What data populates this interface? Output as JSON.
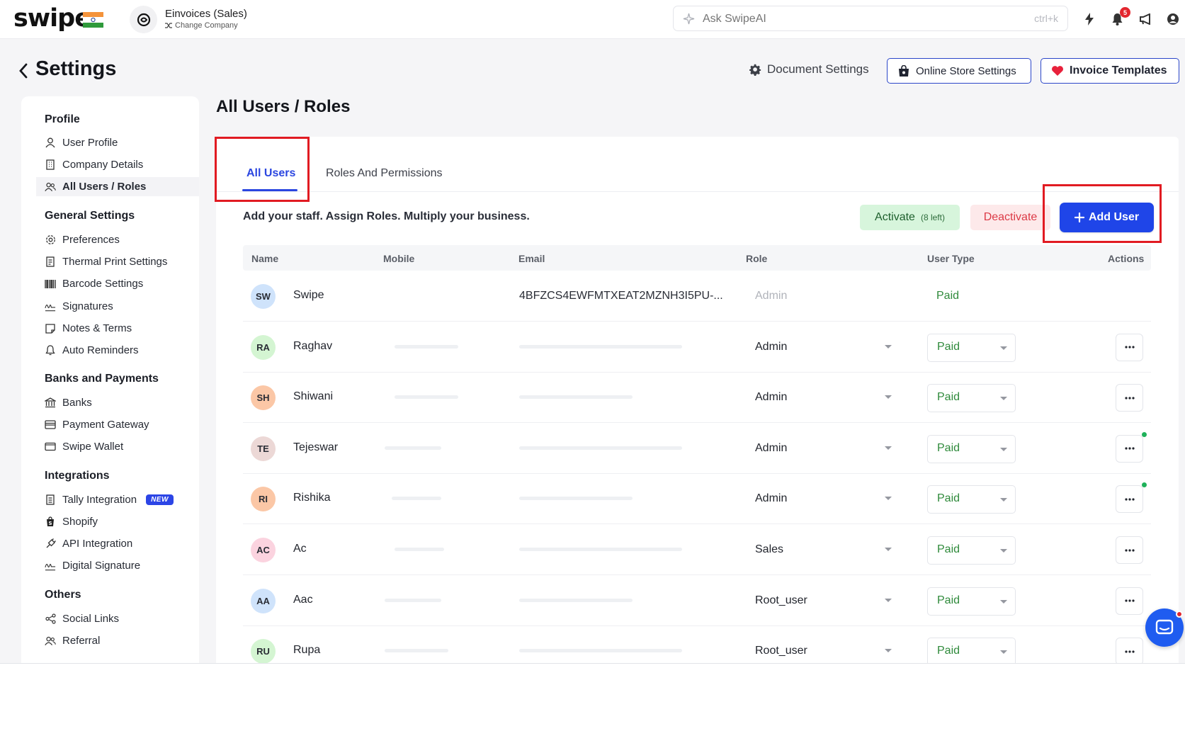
{
  "app": {
    "logo": "swipe",
    "company_name": "Einvoices (Sales)",
    "change_company": "Change Company",
    "ai_placeholder": "Ask SwipeAI",
    "ai_shortcut": "ctrl+k",
    "notification_count": "5"
  },
  "header": {
    "title": "Settings",
    "document_settings": "Document Settings",
    "online_store_settings": "Online Store Settings",
    "invoice_templates": "Invoice Templates"
  },
  "sidebar": {
    "sections": [
      {
        "title": "Profile",
        "items": [
          {
            "label": "User Profile",
            "icon": "user-icon"
          },
          {
            "label": "Company Details",
            "icon": "building-icon"
          },
          {
            "label": "All Users / Roles",
            "icon": "users-icon",
            "active": true
          }
        ]
      },
      {
        "title": "General Settings",
        "items": [
          {
            "label": "Preferences",
            "icon": "gear-icon"
          },
          {
            "label": "Thermal Print Settings",
            "icon": "receipt-icon"
          },
          {
            "label": "Barcode Settings",
            "icon": "barcode-icon"
          },
          {
            "label": "Signatures",
            "icon": "signature-icon"
          },
          {
            "label": "Notes & Terms",
            "icon": "note-icon"
          },
          {
            "label": "Auto Reminders",
            "icon": "bell-icon"
          }
        ]
      },
      {
        "title": "Banks and Payments",
        "items": [
          {
            "label": "Banks",
            "icon": "bank-icon"
          },
          {
            "label": "Payment Gateway",
            "icon": "card-icon"
          },
          {
            "label": "Swipe Wallet",
            "icon": "wallet-icon"
          }
        ]
      },
      {
        "title": "Integrations",
        "items": [
          {
            "label": "Tally Integration",
            "icon": "tally-icon",
            "badge": "NEW"
          },
          {
            "label": "Shopify",
            "icon": "shopify-icon"
          },
          {
            "label": "API Integration",
            "icon": "plug-icon"
          },
          {
            "label": "Digital Signature",
            "icon": "signature-icon"
          }
        ]
      },
      {
        "title": "Others",
        "items": [
          {
            "label": "Social Links",
            "icon": "share-icon"
          },
          {
            "label": "Referral",
            "icon": "users-icon"
          }
        ]
      }
    ]
  },
  "main": {
    "heading": "All Users / Roles",
    "tabs": [
      {
        "label": "All Users",
        "active": true
      },
      {
        "label": "Roles And Permissions",
        "active": false
      }
    ],
    "tagline": "Add your staff. Assign Roles. Multiply your business.",
    "activate_label": "Activate",
    "activate_count": "(8 left)",
    "deactivate_label": "Deactivate",
    "add_user_label": "Add User"
  },
  "table": {
    "columns": [
      "Name",
      "Mobile",
      "Email",
      "Role",
      "User Type",
      "Actions"
    ],
    "rows": [
      {
        "initials": "SW",
        "name": "Swipe",
        "email": "4BFZCS4EWFMTXEAT2MZNH3I5PU-...",
        "role": "Admin",
        "user_type": "Paid",
        "owner": true,
        "avatar_color": "#cfe3fb",
        "online": false
      },
      {
        "initials": "RA",
        "name": "Raghav",
        "email": "",
        "role": "Admin",
        "user_type": "Paid",
        "owner": false,
        "avatar_color": "#d4f5d2",
        "online": false
      },
      {
        "initials": "SH",
        "name": "Shiwani",
        "email": "",
        "role": "Admin",
        "user_type": "Paid",
        "owner": false,
        "avatar_color": "#fbc7a6",
        "online": false
      },
      {
        "initials": "TE",
        "name": "Tejeswar",
        "email": "",
        "role": "Admin",
        "user_type": "Paid",
        "owner": false,
        "avatar_color": "#ecd8d6",
        "online": true
      },
      {
        "initials": "RI",
        "name": "Rishika",
        "email": "",
        "role": "Admin",
        "user_type": "Paid",
        "owner": false,
        "avatar_color": "#fbc7a6",
        "online": true
      },
      {
        "initials": "AC",
        "name": "Ac",
        "email": "",
        "role": "Sales",
        "user_type": "Paid",
        "owner": false,
        "avatar_color": "#fbd3df",
        "online": false
      },
      {
        "initials": "AA",
        "name": "Aac",
        "email": "",
        "role": "Root_user",
        "user_type": "Paid",
        "owner": false,
        "avatar_color": "#cfe3fb",
        "online": false
      },
      {
        "initials": "RU",
        "name": "Rupa",
        "email": "",
        "role": "Root_user",
        "user_type": "Paid",
        "owner": false,
        "avatar_color": "#d4f5d2",
        "online": false
      }
    ]
  },
  "colors": {
    "accent": "#1f45e8",
    "highlight": "#e11b22",
    "paid": "#2f8a3b"
  }
}
